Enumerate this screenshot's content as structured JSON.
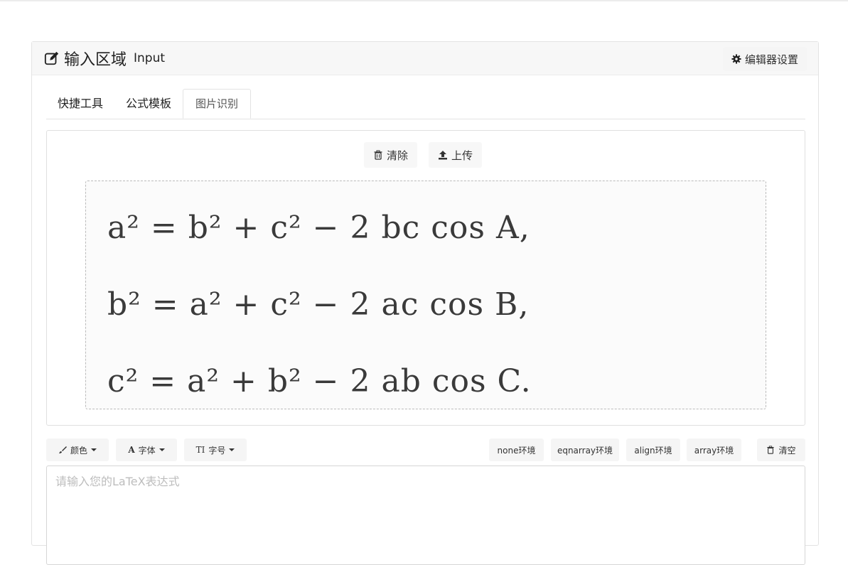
{
  "panel": {
    "title_cn": "输入区域",
    "title_en": "Input",
    "settings_label": "编辑器设置"
  },
  "tabs": [
    {
      "label": "快捷工具"
    },
    {
      "label": "公式模板"
    },
    {
      "label": "图片识别",
      "active": true
    }
  ],
  "ocr": {
    "clear_label": "清除",
    "upload_label": "上传",
    "formulas": [
      "a² = b² + c² − 2 bc cos A,",
      "b² = a² + c² − 2 ac cos B,",
      "c² = a² + b² − 2 ab cos C."
    ]
  },
  "toolbar": {
    "color_label": "颜色",
    "font_label": "字体",
    "size_label": "字号",
    "env_none": "none环境",
    "env_eqnarray": "eqnarray环境",
    "env_align": "align环境",
    "env_array": "array环境",
    "clear_all_label": "清空"
  },
  "input": {
    "placeholder": "请输入您的LaTeX表达式",
    "value": ""
  }
}
